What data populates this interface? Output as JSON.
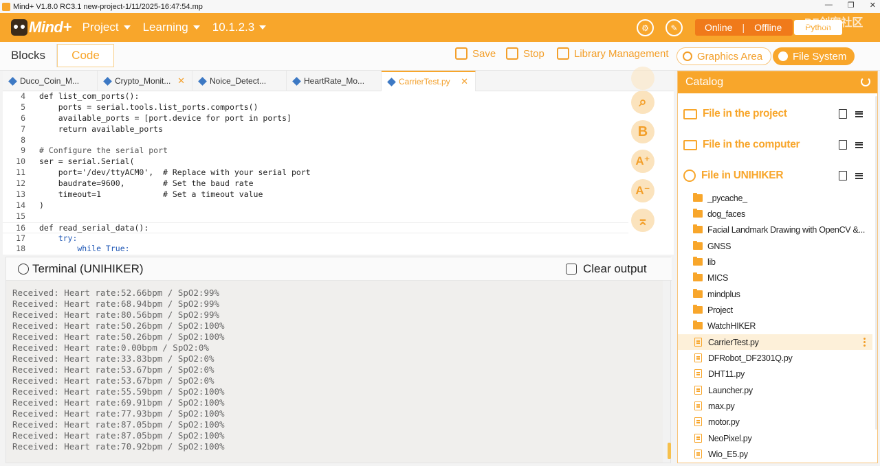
{
  "window": {
    "title": "Mind+ V1.8.0 RC3.1   new-project-1/11/2025-16:47:54.mp",
    "controls": [
      "—",
      "❐",
      "✕"
    ]
  },
  "header": {
    "logo_text": "Mind+",
    "menus": [
      {
        "label": "Project"
      },
      {
        "label": "Learning"
      },
      {
        "label": "10.1.2.3"
      }
    ],
    "mode_online": "Online",
    "mode_separator": "|",
    "mode_offline": "Offline",
    "python_label": "Python",
    "watermark": "DF创客社区",
    "accent_color": "#f8a62b"
  },
  "toolbar": {
    "tab_blocks": "Blocks",
    "tab_code": "Code",
    "save": "Save",
    "stop": "Stop",
    "library": "Library Management",
    "graphics": "Graphics Area",
    "files": "File System"
  },
  "editor": {
    "tabs": [
      {
        "label": "Duco_Coin_M...",
        "active": false,
        "closable": false
      },
      {
        "label": "Crypto_Monit...",
        "active": false,
        "closable": true
      },
      {
        "label": "Noice_Detect...",
        "active": false,
        "closable": false
      },
      {
        "label": "HeartRate_Mo...",
        "active": false,
        "closable": false
      },
      {
        "label": "CarrierTest.py",
        "active": true,
        "closable": true
      }
    ],
    "close_glyph": "✕",
    "lines": [
      {
        "n": "4",
        "text": "def list_com_ports():"
      },
      {
        "n": "5",
        "text": "    ports = serial.tools.list_ports.comports()"
      },
      {
        "n": "6",
        "text": "    available_ports = [port.device for port in ports]"
      },
      {
        "n": "7",
        "text": "    return available_ports"
      },
      {
        "n": "8",
        "text": ""
      },
      {
        "n": "9",
        "text": "# Configure the serial port"
      },
      {
        "n": "10",
        "text": "ser = serial.Serial("
      },
      {
        "n": "11",
        "text": "    port='/dev/ttyACM0',  # Replace with your serial port"
      },
      {
        "n": "12",
        "text": "    baudrate=9600,        # Set the baud rate"
      },
      {
        "n": "13",
        "text": "    timeout=1             # Set a timeout value"
      },
      {
        "n": "14",
        "text": ")"
      },
      {
        "n": "15",
        "text": ""
      },
      {
        "n": "16",
        "text": "def read_serial_data():"
      },
      {
        "n": "17",
        "text": "    try:"
      },
      {
        "n": "18",
        "text": "        while True:"
      }
    ],
    "side_tools": [
      {
        "name": "search-tool",
        "glyph": "⌕"
      },
      {
        "name": "bold-tool",
        "glyph": "B"
      },
      {
        "name": "font-increase-tool",
        "glyph": "A⁺"
      },
      {
        "name": "font-decrease-tool",
        "glyph": "A⁻"
      },
      {
        "name": "scroll-top-tool",
        "glyph": "⌅"
      }
    ]
  },
  "terminal": {
    "title": "Terminal (UNIHIKER)",
    "clear_label": "Clear output",
    "lines": [
      "Received: Heart rate:52.66bpm / SpO2:99%",
      "Received: Heart rate:68.94bpm / SpO2:99%",
      "Received: Heart rate:80.56bpm / SpO2:99%",
      "Received: Heart rate:50.26bpm / SpO2:100%",
      "Received: Heart rate:50.26bpm / SpO2:100%",
      "Received: Heart rate:0.00bpm / SpO2:0%",
      "Received: Heart rate:33.83bpm / SpO2:0%",
      "Received: Heart rate:53.67bpm / SpO2:0%",
      "Received: Heart rate:53.67bpm / SpO2:0%",
      "Received: Heart rate:55.59bpm / SpO2:100%",
      "Received: Heart rate:69.91bpm / SpO2:100%",
      "Received: Heart rate:77.93bpm / SpO2:100%",
      "Received: Heart rate:87.05bpm / SpO2:100%",
      "Received: Heart rate:87.05bpm / SpO2:100%",
      "Received: Heart rate:70.92bpm / SpO2:100%"
    ]
  },
  "catalog": {
    "title": "Catalog",
    "sections": [
      {
        "label": "File in the project"
      },
      {
        "label": "File in the computer"
      },
      {
        "label": "File in UNIHIKER"
      }
    ],
    "items": [
      {
        "label": "_pycache_",
        "type": "folder",
        "selected": false
      },
      {
        "label": "dog_faces",
        "type": "folder",
        "selected": false
      },
      {
        "label": "Facial Landmark Drawing with OpenCV &...",
        "type": "folder",
        "selected": false
      },
      {
        "label": "GNSS",
        "type": "folder",
        "selected": false
      },
      {
        "label": "lib",
        "type": "folder",
        "selected": false
      },
      {
        "label": "MICS",
        "type": "folder",
        "selected": false
      },
      {
        "label": "mindplus",
        "type": "folder",
        "selected": false
      },
      {
        "label": "Project",
        "type": "folder",
        "selected": false
      },
      {
        "label": "WatchHIKER",
        "type": "folder",
        "selected": false
      },
      {
        "label": "CarrierTest.py",
        "type": "file",
        "selected": true
      },
      {
        "label": "DFRobot_DF2301Q.py",
        "type": "file",
        "selected": false
      },
      {
        "label": "DHT11.py",
        "type": "file",
        "selected": false
      },
      {
        "label": "Launcher.py",
        "type": "file",
        "selected": false
      },
      {
        "label": "max.py",
        "type": "file",
        "selected": false
      },
      {
        "label": "motor.py",
        "type": "file",
        "selected": false
      },
      {
        "label": "NeoPixel.py",
        "type": "file",
        "selected": false
      },
      {
        "label": "Wio_E5.py",
        "type": "file",
        "selected": false
      }
    ]
  }
}
